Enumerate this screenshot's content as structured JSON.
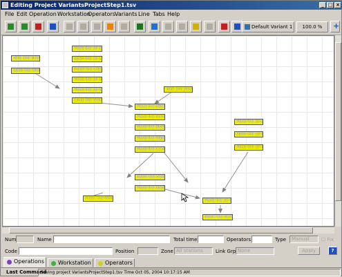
{
  "window": {
    "title": "Editing Project VariantsProjectStep1.tsv"
  },
  "menu": [
    {
      "label": "File"
    },
    {
      "label": "Edit"
    },
    {
      "label": "Operation"
    },
    {
      "label": "Workstation"
    },
    {
      "label": "Operators"
    },
    {
      "label": "Variants"
    },
    {
      "label": "Line"
    },
    {
      "label": "Tabs"
    },
    {
      "label": "Help"
    }
  ],
  "toolbar": {
    "tools": [
      {
        "icon": "new-icon",
        "color": "#2a8a2a",
        "enabled": true
      },
      {
        "icon": "save-icon",
        "color": "#2a8a2a",
        "enabled": true
      },
      {
        "icon": "save-as-icon",
        "color": "#c02020",
        "enabled": true
      },
      {
        "icon": "undo-icon",
        "color": "#2050c0",
        "enabled": true
      },
      {
        "icon": "cut-icon",
        "color": "#808080",
        "enabled": false
      },
      {
        "icon": "copy-icon",
        "color": "#808080",
        "enabled": false
      },
      {
        "icon": "paste-icon",
        "color": "#808080",
        "enabled": false
      },
      {
        "icon": "zoom-icon",
        "color": "#f08000",
        "enabled": true
      },
      {
        "icon": "delete-icon",
        "color": "#808080",
        "enabled": false
      },
      {
        "icon": "search-icon",
        "color": "#207020",
        "enabled": true
      },
      {
        "icon": "select-icon",
        "color": "#2070d0",
        "enabled": true
      },
      {
        "icon": "connect-icon",
        "color": "#808080",
        "enabled": false
      },
      {
        "icon": "disconnect-icon",
        "color": "#808080",
        "enabled": false
      },
      {
        "icon": "link-icon",
        "color": "#d0b000",
        "enabled": true
      },
      {
        "icon": "unlink-icon",
        "color": "#808080",
        "enabled": false
      },
      {
        "icon": "grid-icon",
        "color": "#c02020",
        "enabled": true
      },
      {
        "icon": "minus-icon",
        "color": "#2050c0",
        "enabled": true
      }
    ],
    "variant_label": "Default Variant 1",
    "zoom_label": "100.0 %",
    "plus_label": "+"
  },
  "nodes": [
    {
      "label": "Take and place"
    },
    {
      "label": "Open the White"
    },
    {
      "label": "Place the 10 ch"
    },
    {
      "label": "Open the 10 ch"
    },
    {
      "label": "Insert the Cable"
    },
    {
      "label": "Place the 10 ml"
    },
    {
      "label": "Place the 10 ch"
    },
    {
      "label": "Close the White"
    },
    {
      "label": "Take and place"
    },
    {
      "label": "Place the Heats"
    },
    {
      "label": "Place the Scroll"
    },
    {
      "label": "Place the silver"
    },
    {
      "label": "Place the Wats"
    },
    {
      "label": "Place the Cu M"
    },
    {
      "label": "Place the 10 ch"
    },
    {
      "label": "Open the 10 ch"
    },
    {
      "label": "Place the 10 ml"
    },
    {
      "label": "Insert the Beals"
    },
    {
      "label": "Place the Quick"
    },
    {
      "label": "Insert the White"
    },
    {
      "label": "Place the 10 ch"
    },
    {
      "label": "Insert the Screw"
    }
  ],
  "form": {
    "num_label": "Num",
    "name_label": "Name",
    "total_time_label": "Total time",
    "operators_label": "Operators",
    "type_label": "Type",
    "type_value": "Manual",
    "fix_label": "Fix",
    "code_label": "Code",
    "position_label": "Position",
    "zone_label": "Zone",
    "zone_value": "All stations",
    "linkgrp_label": "Link Grp",
    "linkgrp_value": "None",
    "apply_label": "Apply",
    "help_label": "?"
  },
  "tabs": [
    {
      "label": "Operations",
      "color": "#8040c0",
      "active": true
    },
    {
      "label": "Workstation",
      "color": "#40b040",
      "active": false
    },
    {
      "label": "Operators",
      "color": "#d0d020",
      "active": false
    }
  ],
  "status": {
    "label": "Last Command",
    "message": "Saving project VariantsProjectStep1.tsv Time Oct 05, 2004 10:17:15 AM"
  }
}
